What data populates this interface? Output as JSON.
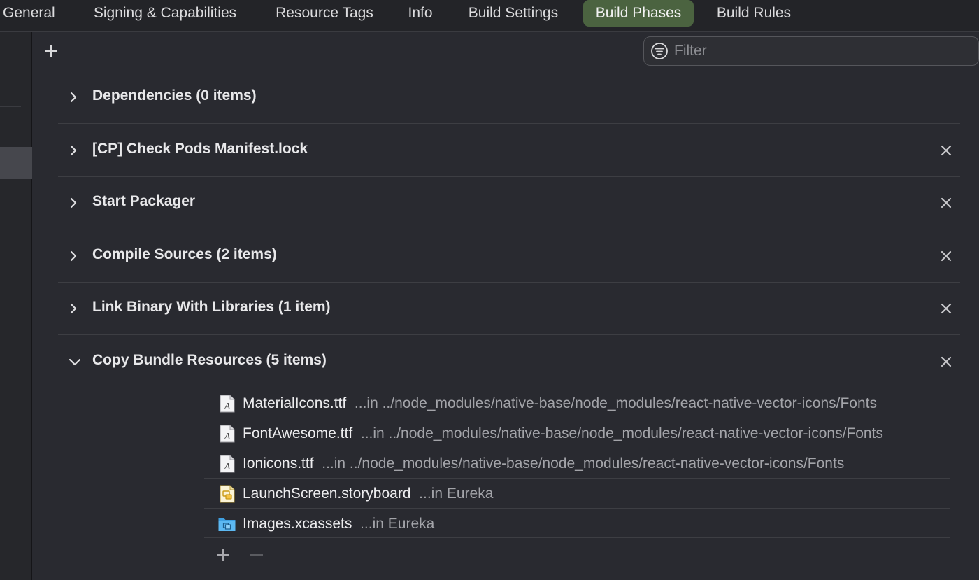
{
  "tabs": [
    {
      "label": "General",
      "active": false
    },
    {
      "label": "Signing & Capabilities",
      "active": false
    },
    {
      "label": "Resource Tags",
      "active": false
    },
    {
      "label": "Info",
      "active": false
    },
    {
      "label": "Build Settings",
      "active": false
    },
    {
      "label": "Build Phases",
      "active": true
    },
    {
      "label": "Build Rules",
      "active": false
    }
  ],
  "toolbar": {
    "filter_placeholder": "Filter",
    "filter_value": ""
  },
  "phases": [
    {
      "title": "Dependencies (0 items)",
      "expanded": false,
      "removable": false
    },
    {
      "title": "[CP] Check Pods Manifest.lock",
      "expanded": false,
      "removable": true
    },
    {
      "title": "Start Packager",
      "expanded": false,
      "removable": true
    },
    {
      "title": "Compile Sources (2 items)",
      "expanded": false,
      "removable": true
    },
    {
      "title": "Link Binary With Libraries (1 item)",
      "expanded": false,
      "removable": true
    },
    {
      "title": "Copy Bundle Resources (5 items)",
      "expanded": true,
      "removable": true
    }
  ],
  "resources": [
    {
      "name": "MaterialIcons.ttf",
      "location": "...in ../node_modules/native-base/node_modules/react-native-vector-icons/Fonts",
      "icon": "font-file-icon"
    },
    {
      "name": "FontAwesome.ttf",
      "location": "...in ../node_modules/native-base/node_modules/react-native-vector-icons/Fonts",
      "icon": "font-file-icon"
    },
    {
      "name": "Ionicons.ttf",
      "location": "...in ../node_modules/native-base/node_modules/react-native-vector-icons/Fonts",
      "icon": "font-file-icon"
    },
    {
      "name": "LaunchScreen.storyboard",
      "location": "...in Eureka",
      "icon": "storyboard-file-icon"
    },
    {
      "name": "Images.xcassets",
      "location": "...in Eureka",
      "icon": "asset-catalog-icon"
    }
  ],
  "colors": {
    "background": "#292a30",
    "active_tab": "#4b6340",
    "text": "#e8e8ea",
    "secondary_text": "#a3a4a9"
  }
}
